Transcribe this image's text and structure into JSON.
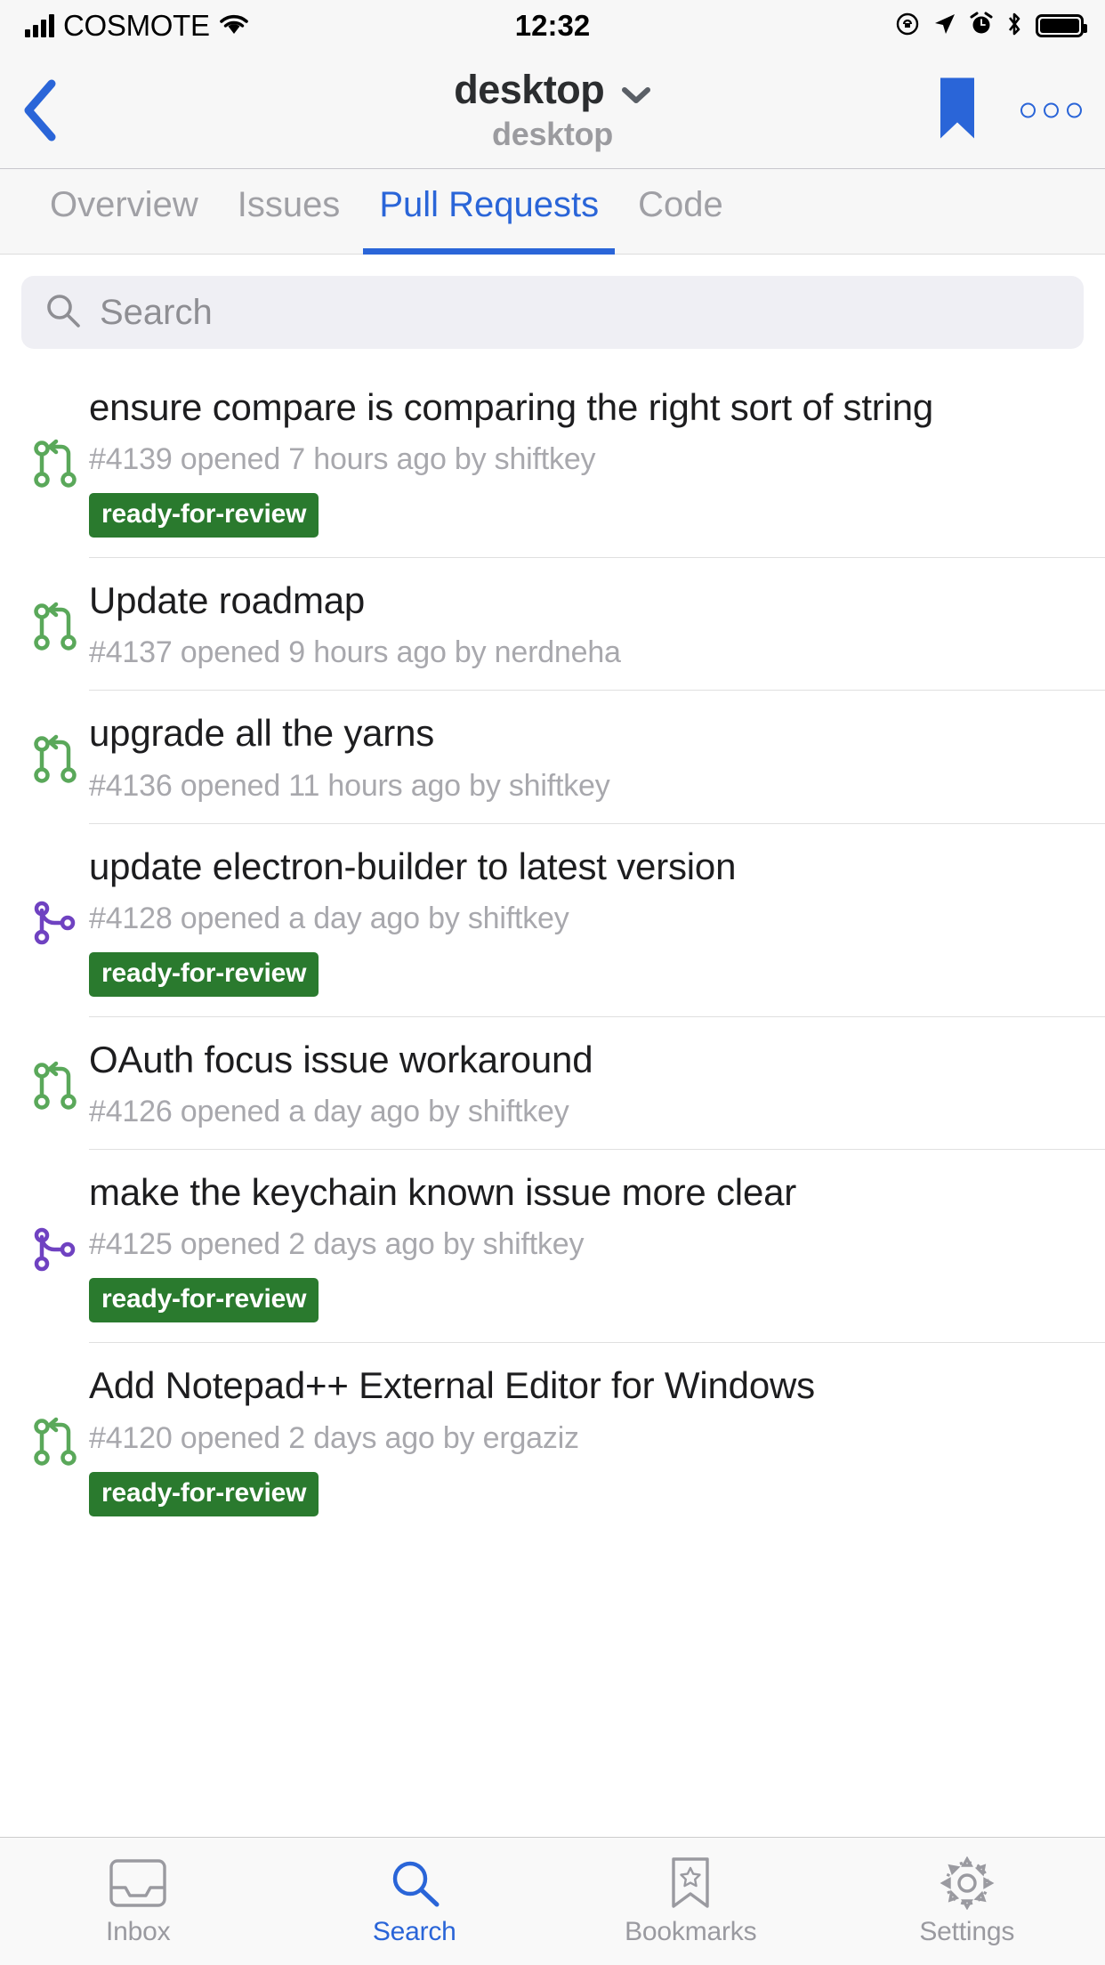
{
  "status_bar": {
    "carrier": "COSMOTE",
    "time": "12:32",
    "icons": [
      "signal-bars-icon",
      "wifi-icon",
      "rotation-lock-icon",
      "location-arrow-icon",
      "alarm-clock-icon",
      "bluetooth-icon",
      "battery-icon"
    ]
  },
  "nav": {
    "back_label": "back-chevron",
    "title": "desktop",
    "subtitle": "desktop",
    "chevron": "chevron-down-icon",
    "bookmark": "bookmark-icon",
    "overflow": "more-options-icon",
    "accent_color": "#2a65d8"
  },
  "tabs": [
    {
      "label": "Overview",
      "active": false
    },
    {
      "label": "Issues",
      "active": false
    },
    {
      "label": "Pull Requests",
      "active": true
    },
    {
      "label": "Code",
      "active": false
    }
  ],
  "search": {
    "placeholder": "Search",
    "icon": "search-icon",
    "value": ""
  },
  "pull_requests": [
    {
      "title": "ensure compare is comparing the right sort of string",
      "meta": "#4139 opened 7 hours ago by shiftkey",
      "number": "#4139",
      "state": "open",
      "icon": "git-pull-request-icon",
      "icon_color": "#5aa85a",
      "labels": [
        "ready-for-review"
      ]
    },
    {
      "title": "Update roadmap",
      "meta": "#4137 opened 9 hours ago by nerdneha",
      "number": "#4137",
      "state": "open",
      "icon": "git-pull-request-icon",
      "icon_color": "#5aa85a",
      "labels": []
    },
    {
      "title": "upgrade all the yarns",
      "meta": "#4136 opened 11 hours ago by shiftkey",
      "number": "#4136",
      "state": "open",
      "icon": "git-pull-request-icon",
      "icon_color": "#5aa85a",
      "labels": []
    },
    {
      "title": "update electron-builder to latest version",
      "meta": "#4128 opened a day ago by shiftkey",
      "number": "#4128",
      "state": "merged",
      "icon": "git-merge-icon",
      "icon_color": "#6f42c1",
      "labels": [
        "ready-for-review"
      ]
    },
    {
      "title": "OAuth focus issue workaround",
      "meta": "#4126 opened a day ago by shiftkey",
      "number": "#4126",
      "state": "open",
      "icon": "git-pull-request-icon",
      "icon_color": "#5aa85a",
      "labels": []
    },
    {
      "title": "make the keychain known issue more clear",
      "meta": "#4125 opened 2 days ago by shiftkey",
      "number": "#4125",
      "state": "merged",
      "icon": "git-merge-icon",
      "icon_color": "#6f42c1",
      "labels": [
        "ready-for-review"
      ]
    },
    {
      "title": "Add Notepad++ External Editor for Windows",
      "meta": "#4120 opened 2 days ago by ergaziz",
      "number": "#4120",
      "state": "open",
      "icon": "git-pull-request-icon",
      "icon_color": "#5aa85a",
      "labels": [
        "ready-for-review"
      ]
    }
  ],
  "label_color": "#2a7a2e",
  "tab_bar": [
    {
      "label": "Inbox",
      "icon": "inbox-icon",
      "active": false
    },
    {
      "label": "Search",
      "icon": "search-icon",
      "active": true
    },
    {
      "label": "Bookmarks",
      "icon": "bookmark-icon",
      "active": false
    },
    {
      "label": "Settings",
      "icon": "gear-icon",
      "active": false
    }
  ]
}
